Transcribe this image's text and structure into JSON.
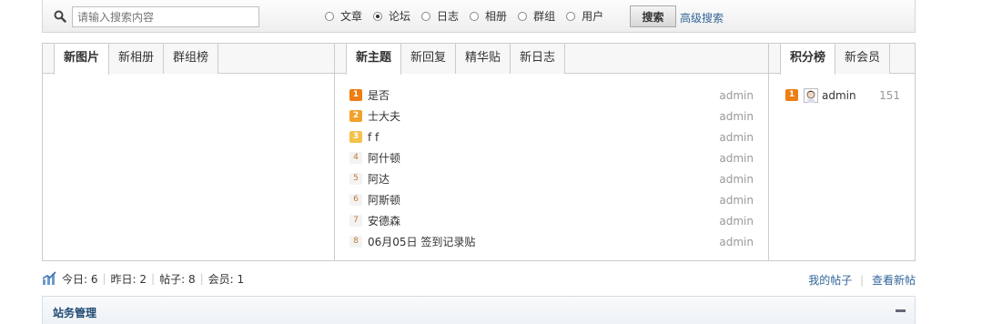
{
  "search": {
    "placeholder": "请输入搜索内容",
    "options": [
      {
        "label": "文章",
        "checked": false
      },
      {
        "label": "论坛",
        "checked": true
      },
      {
        "label": "日志",
        "checked": false
      },
      {
        "label": "相册",
        "checked": false
      },
      {
        "label": "群组",
        "checked": false
      },
      {
        "label": "用户",
        "checked": false
      }
    ],
    "button_label": "搜索",
    "advanced_label": "高级搜索"
  },
  "left_panel": {
    "tabs": [
      "新图片",
      "新相册",
      "群组榜"
    ]
  },
  "middle_panel": {
    "tabs": [
      "新主题",
      "新回复",
      "精华贴",
      "新日志"
    ],
    "items": [
      {
        "rank": "1",
        "title": "是否",
        "author": "admin"
      },
      {
        "rank": "2",
        "title": "士大夫",
        "author": "admin"
      },
      {
        "rank": "3",
        "title": "f f",
        "author": "admin"
      },
      {
        "rank": "4",
        "title": "阿什顿",
        "author": "admin"
      },
      {
        "rank": "5",
        "title": "阿达",
        "author": "admin"
      },
      {
        "rank": "6",
        "title": "阿斯顿",
        "author": "admin"
      },
      {
        "rank": "7",
        "title": "安德森",
        "author": "admin"
      },
      {
        "rank": "8",
        "title": "06月05日 签到记录贴",
        "author": "admin"
      }
    ]
  },
  "right_panel": {
    "tabs": [
      "积分榜",
      "新会员"
    ],
    "items": [
      {
        "rank": "1",
        "user": "admin",
        "score": "151"
      }
    ]
  },
  "stats": {
    "today": "今日: 6",
    "yesterday": "昨日: 2",
    "posts": "帖子: 8",
    "members": "会员: 1"
  },
  "links": {
    "my_posts": "我的帖子",
    "new_posts": "查看新帖"
  },
  "admin_bar": {
    "title": "站务管理"
  }
}
